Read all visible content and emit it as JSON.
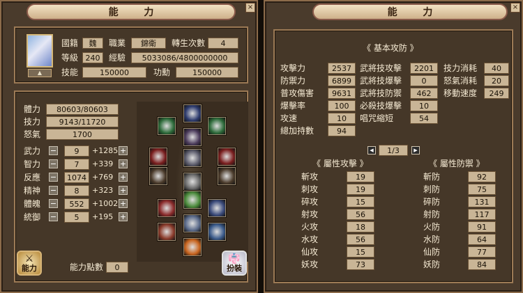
{
  "left": {
    "title": "能 力",
    "info": {
      "nation_label": "國籍",
      "nation_value": "魏",
      "job_label": "職業",
      "job_value": "錦衛",
      "rebirth_label": "轉生次數",
      "rebirth_value": "4",
      "level_label": "等級",
      "level_value": "240",
      "exp_label": "經驗",
      "exp_value": "5033086/4800000000",
      "skill_label": "技能",
      "skill_value": "150000",
      "merit_label": "功勳",
      "merit_value": "150000"
    },
    "vitals": [
      {
        "label": "體力",
        "value": "80603/80603"
      },
      {
        "label": "技力",
        "value": "9143/11720"
      },
      {
        "label": "怒氣",
        "value": "1700"
      }
    ],
    "stats": [
      {
        "label": "武力",
        "value": "9",
        "bonus": "+1285"
      },
      {
        "label": "智力",
        "value": "7",
        "bonus": "+339"
      },
      {
        "label": "反應",
        "value": "1074",
        "bonus": "+769"
      },
      {
        "label": "精神",
        "value": "8",
        "bonus": "+323"
      },
      {
        "label": "體魄",
        "value": "552",
        "bonus": "+1002"
      },
      {
        "label": "統御",
        "value": "5",
        "bonus": "+195"
      }
    ],
    "ability_button": "能力",
    "points_label": "能力點數",
    "points_value": "0",
    "dress_button": "扮裝",
    "equipment_slots": [
      {
        "name": "helmet-slot-icon",
        "color": "#2d3b6e"
      },
      {
        "name": "earring-left-slot-icon",
        "color": "#2d6b3a"
      },
      {
        "name": "earring-right-slot-icon",
        "color": "#2d6b3a"
      },
      {
        "name": "necklace-slot-icon",
        "color": "#4a3a5a"
      },
      {
        "name": "weapon-left-slot-icon",
        "color": "#7a1e1e"
      },
      {
        "name": "armor-slot-icon",
        "color": "#5a5a6a"
      },
      {
        "name": "weapon-right-slot-icon",
        "color": "#7a1e1e"
      },
      {
        "name": "offhand-left-slot-icon",
        "color": "#4a3a2a"
      },
      {
        "name": "belt-slot-icon",
        "color": "#6a6a6a"
      },
      {
        "name": "offhand-right-slot-icon",
        "color": "#4a3a2a"
      },
      {
        "name": "glove-slot-icon",
        "color": "#8a2a2a"
      },
      {
        "name": "pants-slot-icon",
        "color": "#4a8a3a"
      },
      {
        "name": "ring-slot-icon",
        "color": "#3a4a7a"
      },
      {
        "name": "bracelet-slot-icon",
        "color": "#8a3a2a"
      },
      {
        "name": "boots-slot-icon",
        "color": "#5a6a8a"
      },
      {
        "name": "talisman-slot-icon",
        "color": "#3a5a8a"
      },
      {
        "name": "flame-slot-icon",
        "color": "#c8641e"
      }
    ]
  },
  "right": {
    "title": "能 力",
    "basic_title": "《 基本攻防 》",
    "basic": [
      {
        "label": "攻擊力",
        "value": "2537"
      },
      {
        "label": "防禦力",
        "value": "6899"
      },
      {
        "label": "普攻傷害",
        "value": "9631"
      },
      {
        "label": "爆擊率",
        "value": "100"
      },
      {
        "label": "攻速",
        "value": "10"
      },
      {
        "label": "總加持數",
        "value": "94"
      }
    ],
    "general": [
      {
        "label": "武將技攻擊",
        "value": "2201"
      },
      {
        "label": "武將技爆擊",
        "value": "0"
      },
      {
        "label": "武將技防禦",
        "value": "462"
      },
      {
        "label": "必殺技爆擊",
        "value": "10"
      },
      {
        "label": "唱咒縮短",
        "value": "54"
      }
    ],
    "extra": [
      {
        "label": "技力消耗",
        "value": "40"
      },
      {
        "label": "怒氣消耗",
        "value": "20"
      },
      {
        "label": "移動速度",
        "value": "249"
      }
    ],
    "page": "1/3",
    "attr_atk_title": "《 屬性攻擊 》",
    "attr_def_title": "《 屬性防禦 》",
    "attr_atk": [
      {
        "label": "斬攻",
        "value": "19"
      },
      {
        "label": "刺攻",
        "value": "19"
      },
      {
        "label": "碎攻",
        "value": "15"
      },
      {
        "label": "射攻",
        "value": "56"
      },
      {
        "label": "火攻",
        "value": "18"
      },
      {
        "label": "水攻",
        "value": "56"
      },
      {
        "label": "仙攻",
        "value": "15"
      },
      {
        "label": "妖攻",
        "value": "73"
      }
    ],
    "attr_def": [
      {
        "label": "斬防",
        "value": "92"
      },
      {
        "label": "刺防",
        "value": "75"
      },
      {
        "label": "碎防",
        "value": "131"
      },
      {
        "label": "射防",
        "value": "117"
      },
      {
        "label": "火防",
        "value": "91"
      },
      {
        "label": "水防",
        "value": "64"
      },
      {
        "label": "仙防",
        "value": "77"
      },
      {
        "label": "妖防",
        "value": "84"
      }
    ]
  }
}
